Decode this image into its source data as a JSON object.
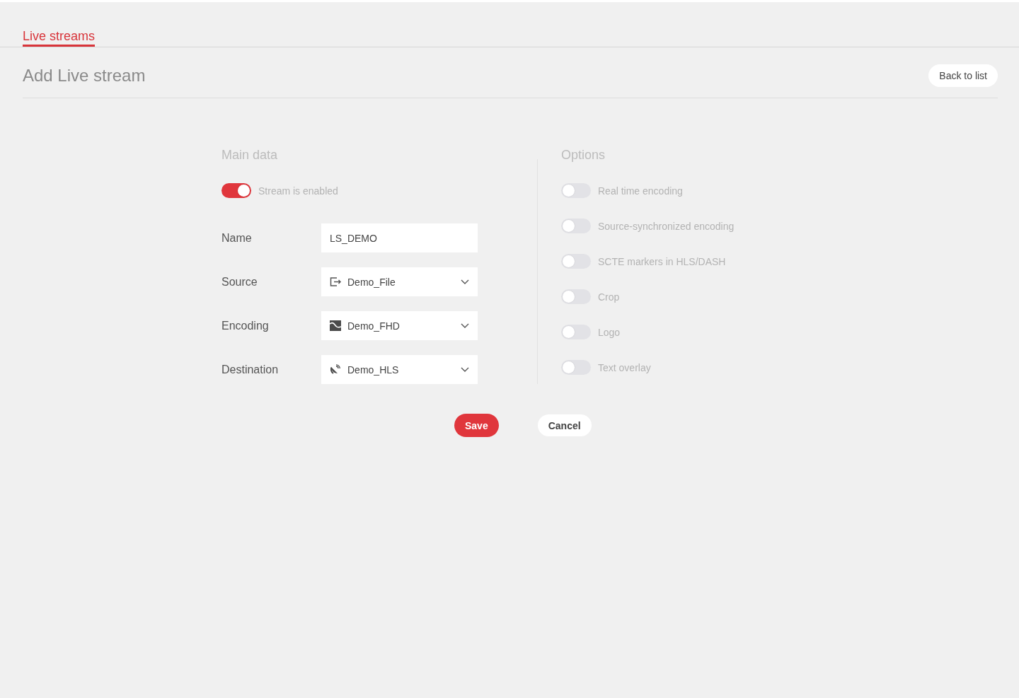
{
  "top_tabs": [
    {
      "label": "Live streams",
      "selected": true
    }
  ],
  "page_header": {
    "title": "Add Live stream",
    "back_button": "Back to list"
  },
  "main_data": {
    "title": "Main data",
    "enabled": {
      "label": "Stream is enabled",
      "on": true
    },
    "fields": [
      {
        "label": "Name",
        "kind": "text",
        "value": "LS_DEMO"
      },
      {
        "label": "Source",
        "kind": "select",
        "value": "Demo_File"
      },
      {
        "label": "Encoding",
        "kind": "select",
        "value": "Demo_FHD"
      },
      {
        "label": "Destination",
        "kind": "select",
        "value": "Demo_HLS"
      }
    ]
  },
  "options": {
    "title": "Options",
    "toggles": [
      {
        "label": "Real time encoding",
        "on": false
      },
      {
        "label": "Source-synchronized encoding",
        "on": false
      },
      {
        "label": "SCTE markers in HLS/DASH",
        "on": false
      },
      {
        "label": "Crop",
        "on": false
      },
      {
        "label": "Logo",
        "on": false
      },
      {
        "label": "Text overlay",
        "on": false
      }
    ]
  },
  "actions": [
    {
      "label": "Save",
      "kind": "primary"
    },
    {
      "label": "Cancel",
      "kind": "secondary"
    }
  ]
}
